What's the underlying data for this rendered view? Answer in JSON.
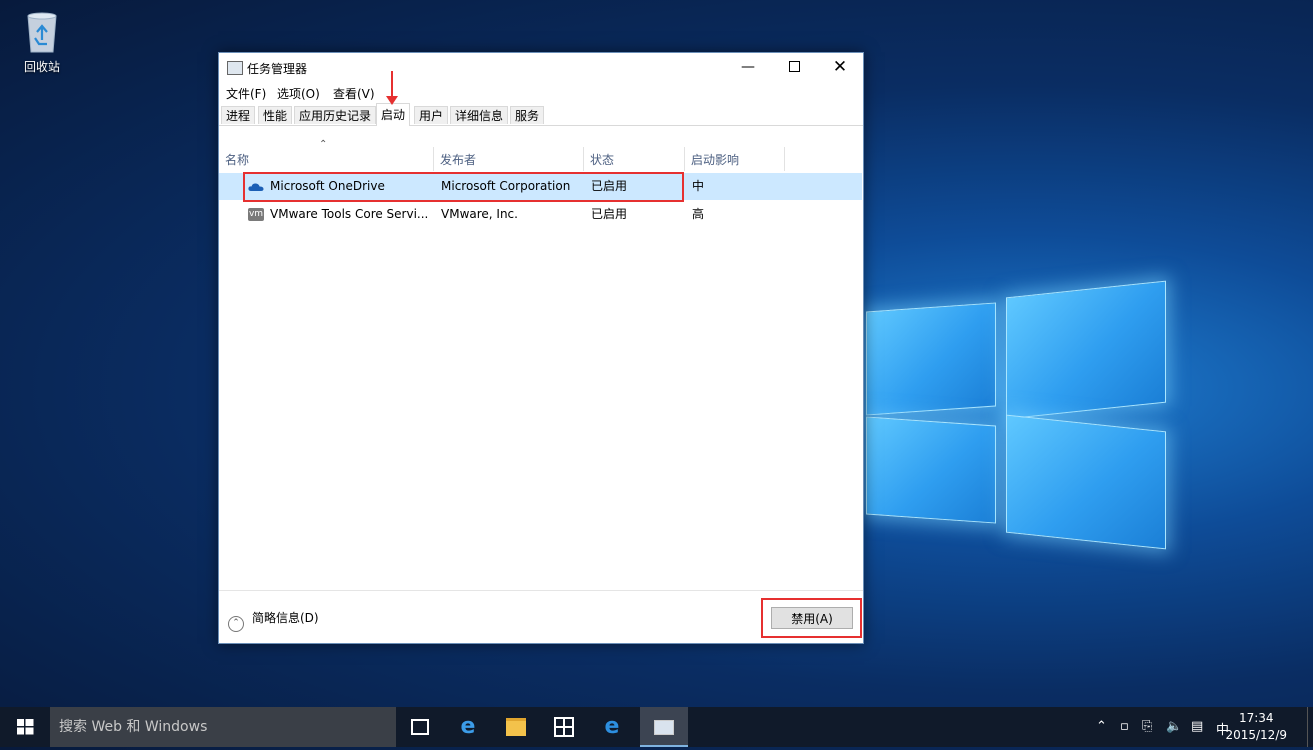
{
  "desktop": {
    "recycle_bin_label": "回收站"
  },
  "window": {
    "title": "任务管理器",
    "menu": [
      "文件(F)",
      "选项(O)",
      "查看(V)"
    ],
    "tabs": [
      "进程",
      "性能",
      "应用历史记录",
      "启动",
      "用户",
      "详细信息",
      "服务"
    ],
    "active_tab": "启动",
    "columns": [
      "名称",
      "发布者",
      "状态",
      "启动影响"
    ],
    "rows": [
      {
        "name": "Microsoft OneDrive",
        "publisher": "Microsoft Corporation",
        "status": "已启用",
        "impact": "中",
        "icon": "onedrive-icon",
        "selected": true
      },
      {
        "name": "VMware Tools Core Servi...",
        "publisher": "VMware, Inc.",
        "status": "已启用",
        "impact": "高",
        "icon": "vmware-icon",
        "icon_text": "vm",
        "selected": false
      }
    ],
    "fewer_details_label": "简略信息(D)",
    "disable_button_label": "禁用(A)"
  },
  "taskbar": {
    "search_placeholder": "搜索 Web 和 Windows",
    "ime": "中",
    "time": "17:34",
    "date": "2015/12/9"
  },
  "colors": {
    "highlight_red": "#e63030",
    "selected_row": "#cce8ff"
  }
}
